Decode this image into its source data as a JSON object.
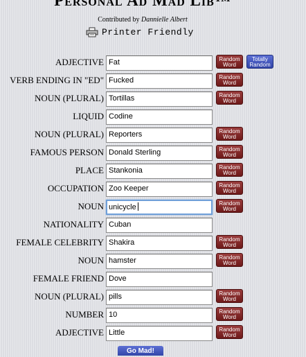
{
  "header": {
    "title": "Personal Ad Mad Lib™",
    "credit_prefix": "Contributed by",
    "credit_author": "Dannielle Albert",
    "printer_label": "Printer Friendly"
  },
  "buttons": {
    "random_word_line1": "Random",
    "random_word_line2": "Word",
    "totally_random_line1": "Totally",
    "totally_random_line2": "Random",
    "go_label": "Go Mad!"
  },
  "fields": [
    {
      "label": "ADJECTIVE",
      "value": "Fat",
      "random": true,
      "totally": true
    },
    {
      "label": "VERB ENDING IN \"ED\"",
      "value": "Fucked",
      "random": true
    },
    {
      "label": "NOUN (PLURAL)",
      "value": "Tortillas",
      "random": true
    },
    {
      "label": "LIQUID",
      "value": "Codine",
      "random": false
    },
    {
      "label": "NOUN (PLURAL)",
      "value": "Reporters",
      "random": true
    },
    {
      "label": "FAMOUS PERSON",
      "value": "Donald Sterling",
      "random": true
    },
    {
      "label": "PLACE",
      "value": "Stankonia",
      "random": true
    },
    {
      "label": "OCCUPATION",
      "value": "Zoo Keeper",
      "random": true
    },
    {
      "label": "NOUN",
      "value": "unicycle",
      "random": true,
      "focused": true
    },
    {
      "label": "NATIONALITY",
      "value": "Cuban",
      "random": false
    },
    {
      "label": "FEMALE CELEBRITY",
      "value": "Shakira",
      "random": true
    },
    {
      "label": "NOUN",
      "value": "hamster",
      "random": true
    },
    {
      "label": "FEMALE FRIEND",
      "value": "Dove",
      "random": false
    },
    {
      "label": "NOUN (PLURAL)",
      "value": "pills",
      "random": true
    },
    {
      "label": "NUMBER",
      "value": "10",
      "random": true
    },
    {
      "label": "ADJECTIVE",
      "value": "Little",
      "random": true
    }
  ],
  "colors": {
    "random_button": "#7a2020",
    "totally_random_button": "#3a4fb8",
    "focus_ring": "#6f9fd8"
  }
}
